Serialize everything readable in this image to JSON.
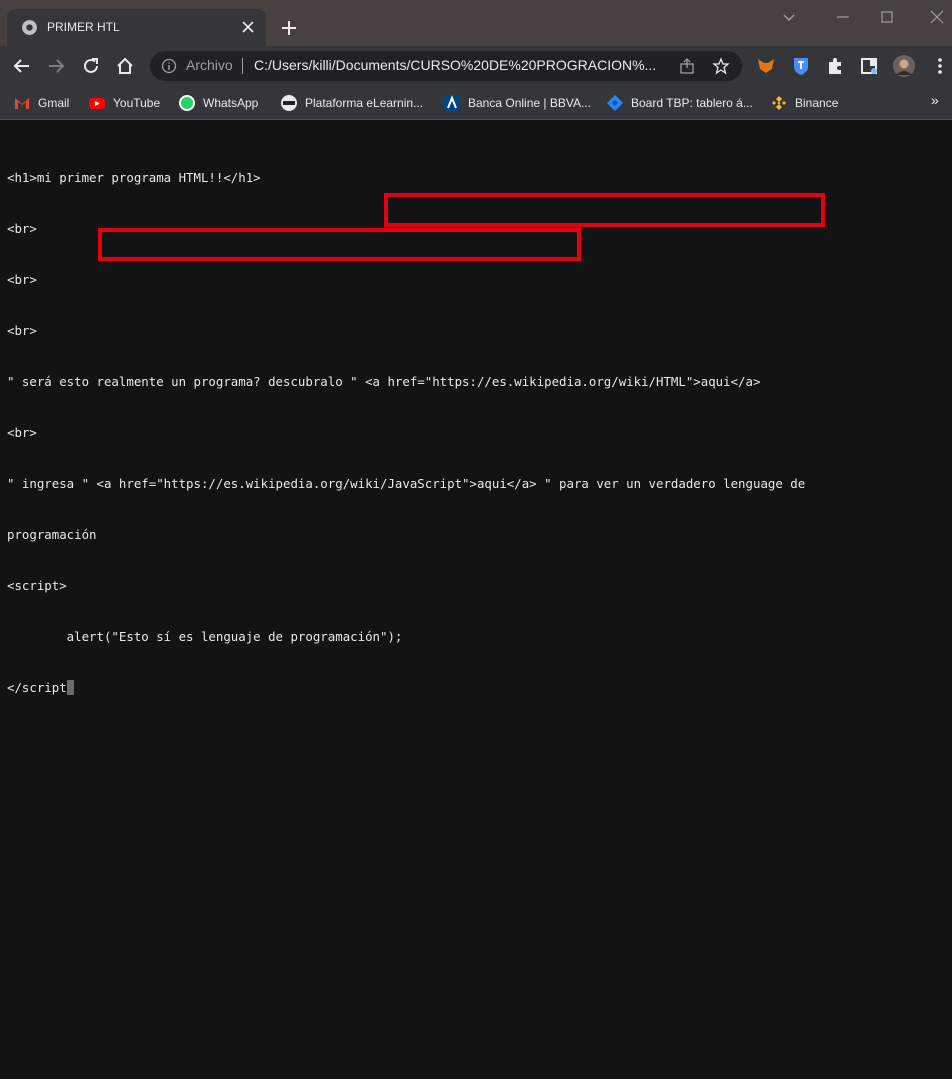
{
  "tab": {
    "title": "PRIMER HTL"
  },
  "omnibox": {
    "chip": "Archivo",
    "url": "C:/Users/killi/Documents/CURSO%20DE%20PROGRACION%..."
  },
  "bookmarks": [
    {
      "label": "Gmail",
      "icon": "gmail-icon"
    },
    {
      "label": "YouTube",
      "icon": "youtube-icon"
    },
    {
      "label": "WhatsApp",
      "icon": "whatsapp-icon"
    },
    {
      "label": "Plataforma eLearnin...",
      "icon": "coder-icon"
    },
    {
      "label": "Banca Online | BBVA...",
      "icon": "bbva-icon"
    },
    {
      "label": "Board TBP: tablero á...",
      "icon": "jira-icon"
    },
    {
      "label": "Binance",
      "icon": "binance-icon"
    }
  ],
  "bookmarks_more": "»",
  "source": {
    "lines": [
      "<h1>mi primer programa HTML!!</h1>",
      "<br>",
      "<br>",
      "<br>",
      "\" será esto realmente un programa? descubralo \" <a href=\"https://es.wikipedia.org/wiki/HTML\">aqui</a>",
      "<br>",
      "\" ingresa \" <a href=\"https://es.wikipedia.org/wiki/JavaScript\">aqui</a> \" para ver un verdadero lenguage de",
      "programación",
      "<script>",
      "        alert(\"Esto sí es lenguaje de programación\");",
      "</script"
    ],
    "cursor_char": ">"
  },
  "colors": {
    "highlight": "#e3000f",
    "background": "#131313",
    "text": "#e8e8e8"
  }
}
